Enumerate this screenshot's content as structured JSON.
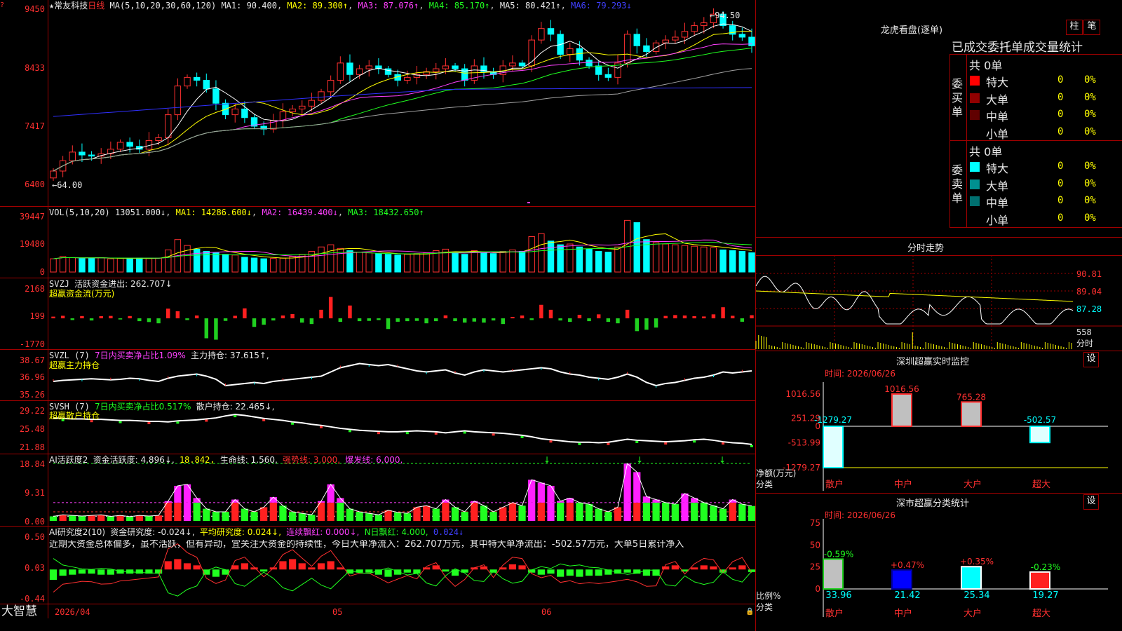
{
  "main_chart": {
    "header": {
      "star": "★",
      "name": "常友科技",
      "period": "日线",
      "ma_def": "MA(5,10,20,30,60,120)",
      "ma1": "MA1: 90.400",
      "ma2": "MA2: 89.300↑",
      "ma3": "MA3: 87.076↑",
      "ma4": "MA4: 85.170↑",
      "ma5": "MA5: 80.421↑",
      "ma6": "MA6: 79.293↓"
    },
    "y_ticks": [
      "9450",
      "8433",
      "7417",
      "6400"
    ],
    "high_label": "←94.50",
    "low_label": "←64.00",
    "date_labels": [
      "2026/04",
      "05",
      "06"
    ],
    "logo": "大智慧"
  },
  "vol_panel": {
    "header": {
      "def": "VOL(5,10,20)",
      "v": "13051.000↓",
      "ma1": "MA1: 14286.600↓",
      "ma2": "MA2: 16439.400↓",
      "ma3": "MA3: 18432.650↑"
    },
    "y_ticks": [
      "39447",
      "19480",
      "0"
    ]
  },
  "svzj_panel": {
    "header": {
      "def": "SVZJ",
      "desc": "活跃资金进出: 262.707↓",
      "title": "超赢资金流(万元)"
    },
    "y_ticks": [
      "2168",
      "199",
      "-1770"
    ]
  },
  "svzl_panel": {
    "header": {
      "def": "SVZL (7)",
      "desc": "7日内买卖净占比1.09%",
      "hold": "主力持仓: 37.615↑,",
      "title": "超赢主力持仓"
    },
    "y_ticks": [
      "38.67",
      "36.96",
      "35.26"
    ]
  },
  "svsh_panel": {
    "header": {
      "def": "SVSH (7)",
      "desc": "7日内买卖净占比0.517%",
      "hold": "散户持仓: 22.465↓,",
      "title": "超赢散户持仓"
    },
    "y_ticks": [
      "29.22",
      "25.48",
      "21.88"
    ]
  },
  "ai_active_panel": {
    "header": {
      "def": "AI活跃度2",
      "a": "资金活跃度: 4.896↓,",
      "b": "18.842,",
      "c": "生命线: 1.560,",
      "d": "强势线: 3.000,",
      "e": "爆发线: 6.000,"
    },
    "y_ticks": [
      "18.84",
      "9.31",
      "0.00"
    ]
  },
  "ai_research_panel": {
    "header": {
      "def": "AI研究度2(10)",
      "a": "资金研究度: -0.024↓,",
      "b": "平均研究度: 0.024↓,",
      "c": "连续飘红: 0.000↓,",
      "d": "N日飘红: 4.000,",
      "e": "0.024↓"
    },
    "commentary": "近期大资金总体偏多，虽不活跃，但有异动，宜关注大资金的持续性，今日大单净流入：262.707万元，其中特大单净流出：-502.57万元，大单5日累计净入",
    "y_ticks": [
      "0.50",
      "0.03",
      "-0.44"
    ]
  },
  "dragon_panel": {
    "title": "龙虎看盘(逐单)",
    "btn_bar": "柱",
    "btn_pen": "笔",
    "tabs": "已成交委托单成交量统计",
    "buy_label": "委买单",
    "sell_label": "委卖单",
    "buy_total": "共 0单",
    "sell_total": "共 0单",
    "buy_rows": [
      {
        "name": "特大",
        "value": "0",
        "pct": "0%",
        "color": "#ff0000"
      },
      {
        "name": "大单",
        "value": "0",
        "pct": "0%",
        "color": "#900000"
      },
      {
        "name": "中单",
        "value": "0",
        "pct": "0%",
        "color": "#600000"
      },
      {
        "name": "小单",
        "value": "0",
        "pct": "0%",
        "color": ""
      }
    ],
    "sell_rows": [
      {
        "name": "特大",
        "value": "0",
        "pct": "0%",
        "color": "#00ffff"
      },
      {
        "name": "大单",
        "value": "0",
        "pct": "0%",
        "color": "#009090"
      },
      {
        "name": "中单",
        "value": "0",
        "pct": "0%",
        "color": "#007070"
      },
      {
        "name": "小单",
        "value": "0",
        "pct": "0%",
        "color": ""
      }
    ]
  },
  "intraday_panel": {
    "title": "分时走势",
    "y_ticks": [
      "90.81",
      "89.04",
      "87.28"
    ],
    "vol_tick": "558",
    "vol_label": "分时"
  },
  "monitor_panel": {
    "title": "深圳超赢实时监控",
    "setting": "设",
    "time": "时间: 2026/06/26",
    "y_ticks": [
      "1016.56",
      "251.29",
      "0",
      "-513.99",
      "-1279.27"
    ],
    "y_label_1": "净额(万元)",
    "y_label_2": "分类",
    "categories": [
      "散户",
      "中户",
      "大户",
      "超大"
    ],
    "value_labels": [
      "-1279.27",
      "1016.56",
      "765.28",
      "-502.57"
    ]
  },
  "category_panel": {
    "title": "深市超赢分类统计",
    "setting": "设",
    "time": "时间: 2026/06/26",
    "y_ticks": [
      "75",
      "50",
      "25",
      "0"
    ],
    "y_label_1": "比例%",
    "y_label_2": "分类",
    "categories": [
      "散户",
      "中户",
      "大户",
      "超大"
    ],
    "pct_labels": [
      "-0.59%",
      "+0.47%",
      "+0.35%",
      "-0.23%"
    ],
    "values": [
      "33.96",
      "21.42",
      "25.34",
      "19.27"
    ]
  },
  "chart_data": [
    {
      "type": "candlestick",
      "title": "常友科技 日线",
      "ylim": [
        64.0,
        94.5
      ],
      "series": [
        {
          "name": "MA1",
          "values": [
            90.4
          ]
        },
        {
          "name": "MA2",
          "values": [
            89.3
          ]
        },
        {
          "name": "MA3",
          "values": [
            87.076
          ]
        },
        {
          "name": "MA4",
          "values": [
            85.17
          ]
        },
        {
          "name": "MA5",
          "values": [
            80.421
          ]
        },
        {
          "name": "MA6",
          "values": [
            79.293
          ]
        }
      ],
      "close": [
        66.2,
        68.0,
        69.5,
        69.0,
        68.8,
        69.2,
        70.0,
        71.2,
        70.5,
        70.0,
        71.5,
        72.0,
        76.0,
        81.0,
        82.5,
        82.0,
        80.5,
        78.0,
        76.0,
        77.0,
        75.5,
        74.0,
        73.5,
        75.0,
        76.5,
        77.0,
        77.5,
        78.5,
        80.0,
        82.0,
        85.0,
        83.0,
        84.0,
        84.5,
        84.0,
        83.0,
        82.0,
        82.5,
        83.0,
        83.5,
        84.0,
        84.5,
        84.0,
        82.0,
        84.5,
        83.5,
        83.0,
        84.5,
        85.0,
        84.5,
        89.0,
        91.0,
        90.0,
        86.5,
        87.5,
        85.5,
        84.5,
        83.0,
        82.5,
        85.0,
        90.0,
        88.0,
        87.0,
        88.5,
        89.0,
        89.5,
        90.5,
        91.5,
        92.0,
        93.5,
        91.5,
        90.0,
        89.5,
        88.0
      ]
    },
    {
      "type": "bar",
      "title": "VOL(5,10,20)",
      "ylim": [
        0,
        39447
      ],
      "values": [
        9000,
        10500,
        9800,
        9200,
        9500,
        9700,
        9000,
        9300,
        8900,
        9500,
        9200,
        9400,
        15000,
        22000,
        18000,
        15500,
        14000,
        13000,
        12000,
        11500,
        10000,
        9500,
        9000,
        9200,
        9400,
        10500,
        12000,
        14000,
        17000,
        18500,
        16000,
        14500,
        13500,
        13000,
        12500,
        12000,
        11500,
        12000,
        12500,
        13000,
        14500,
        15500,
        13500,
        12000,
        14500,
        13000,
        12500,
        14000,
        15000,
        14000,
        24000,
        26000,
        21000,
        18500,
        19000,
        17000,
        15500,
        14000,
        13500,
        17000,
        35000,
        33500,
        22000,
        20000,
        19000,
        18500,
        18000,
        17500,
        17000,
        16500,
        15000,
        14500,
        14000,
        13051
      ]
    },
    {
      "type": "bar",
      "title": "超赢资金流(万元)",
      "ylim": [
        -1770,
        2168
      ],
      "values": [
        120,
        180,
        -120,
        160,
        -150,
        150,
        170,
        -80,
        160,
        -200,
        -260,
        -350,
        680,
        500,
        -120,
        200,
        -1400,
        -1500,
        -180,
        180,
        700,
        -600,
        -450,
        -150,
        200,
        300,
        -300,
        -400,
        600,
        1500,
        -250,
        900,
        -200,
        -180,
        -120,
        -750,
        -240,
        -200,
        -180,
        -350,
        -200,
        210,
        -200,
        -300,
        -230,
        -300,
        -150,
        -400,
        100,
        200,
        -120,
        950,
        600,
        -150,
        -250,
        250,
        -200,
        280,
        -250,
        -350,
        600,
        -900,
        -800,
        -650,
        170,
        230,
        200,
        150,
        130,
        280,
        780,
        180,
        -240,
        220
      ]
    },
    {
      "type": "line",
      "title": "超赢主力持仓",
      "ylim": [
        35.26,
        38.67
      ],
      "values": [
        36.6,
        36.7,
        36.75,
        36.8,
        36.85,
        36.8,
        36.75,
        36.8,
        36.9,
        36.85,
        36.7,
        36.6,
        36.9,
        37.1,
        37.2,
        37.3,
        37.1,
        36.8,
        36.2,
        36.3,
        36.4,
        36.5,
        36.4,
        36.6,
        36.7,
        36.8,
        36.9,
        37.0,
        37.1,
        37.5,
        37.9,
        38.1,
        38.3,
        38.2,
        38.1,
        38.2,
        38.0,
        37.8,
        37.6,
        37.5,
        37.6,
        37.7,
        37.4,
        37.2,
        37.5,
        37.7,
        37.6,
        37.5,
        37.6,
        37.7,
        37.8,
        37.9,
        37.8,
        37.5,
        37.3,
        37.2,
        37.0,
        36.9,
        36.8,
        37.0,
        37.3,
        37.0,
        36.5,
        36.2,
        36.4,
        36.5,
        36.7,
        36.9,
        37.0,
        37.2,
        37.5,
        37.4,
        37.5,
        37.6
      ]
    },
    {
      "type": "line",
      "title": "超赢散户持仓",
      "ylim": [
        21.88,
        29.22
      ],
      "values": [
        27.8,
        27.7,
        27.6,
        27.6,
        27.5,
        27.5,
        27.4,
        27.3,
        27.3,
        27.2,
        27.1,
        27.1,
        27.0,
        27.2,
        27.3,
        27.4,
        27.6,
        27.8,
        28.2,
        28.5,
        28.3,
        28.0,
        27.7,
        27.5,
        27.3,
        27.0,
        26.8,
        26.5,
        26.3,
        26.0,
        25.7,
        25.5,
        25.3,
        25.2,
        25.1,
        25.0,
        25.0,
        25.1,
        25.2,
        25.1,
        25.0,
        24.8,
        25.0,
        25.2,
        25.0,
        24.9,
        24.8,
        24.7,
        24.5,
        24.3,
        24.0,
        23.6,
        23.4,
        23.2,
        23.0,
        22.9,
        22.9,
        22.8,
        22.9,
        23.2,
        23.5,
        23.3,
        23.2,
        23.1,
        23.0,
        23.1,
        23.2,
        23.4,
        23.5,
        23.3,
        23.0,
        22.8,
        22.7,
        22.47
      ]
    },
    {
      "type": "bar",
      "title": "AI活跃度2",
      "ylim": [
        0,
        18.84
      ],
      "values": [
        1.5,
        2.0,
        1.8,
        1.6,
        1.8,
        2.0,
        1.5,
        1.8,
        1.4,
        1.8,
        1.6,
        1.8,
        6.5,
        11.5,
        12.0,
        7.5,
        4.0,
        3.0,
        3.0,
        7.0,
        4.0,
        3.0,
        4.5,
        7.8,
        5.0,
        3.0,
        2.5,
        2.0,
        6.5,
        12.0,
        7.5,
        4.0,
        3.0,
        2.5,
        2.0,
        3.5,
        2.8,
        2.5,
        4.5,
        5.0,
        4.0,
        7.0,
        4.5,
        3.0,
        6.5,
        5.0,
        3.0,
        4.5,
        6.0,
        5.0,
        13.5,
        12.5,
        11.5,
        6.5,
        7.5,
        6.0,
        5.5,
        4.0,
        3.0,
        4.5,
        18.8,
        16.0,
        8.0,
        7.0,
        6.0,
        5.5,
        9.0,
        7.5,
        6.0,
        5.0,
        4.0,
        7.0,
        5.5,
        4.9
      ]
    },
    {
      "type": "bar",
      "title": "AI研究度2(10)",
      "ylim": [
        -0.44,
        0.5
      ],
      "values": [
        -0.1,
        -0.06,
        -0.05,
        -0.04,
        -0.04,
        -0.05,
        -0.05,
        -0.04,
        -0.04,
        -0.04,
        -0.04,
        -0.04,
        0.08,
        0.1,
        0.06,
        0.04,
        -0.05,
        -0.07,
        -0.05,
        0.04,
        0.06,
        0.02,
        -0.02,
        0.02,
        0.08,
        0.1,
        0.06,
        0.02,
        0.06,
        0.08,
        0.02,
        -0.04,
        -0.03,
        -0.03,
        -0.05,
        -0.07,
        -0.05,
        -0.03,
        -0.04,
        0.02,
        0.04,
        -0.02,
        -0.06,
        -0.03,
        0.02,
        0.03,
        -0.03,
        0.02,
        0.05,
        0.04,
        -0.03,
        -0.05,
        -0.04,
        -0.07,
        -0.06,
        -0.07,
        -0.06,
        -0.06,
        -0.05,
        -0.04,
        -0.03,
        -0.04,
        -0.06,
        -0.06,
        0.03,
        0.04,
        -0.02,
        0.02,
        0.04,
        0.03,
        -0.03,
        0.02,
        0.04,
        -0.024
      ]
    },
    {
      "type": "bar",
      "title": "深圳超赢实时监控",
      "categories": [
        "散户",
        "中户",
        "大户",
        "超大"
      ],
      "values": [
        -1279.27,
        1016.56,
        765.28,
        -502.57
      ],
      "ylim": [
        -1279.27,
        1016.56
      ]
    },
    {
      "type": "bar",
      "title": "深市超赢分类统计",
      "categories": [
        "散户",
        "中户",
        "大户",
        "超大"
      ],
      "values": [
        33.96,
        21.42,
        25.34,
        19.27
      ],
      "ylim": [
        0,
        75
      ]
    }
  ]
}
